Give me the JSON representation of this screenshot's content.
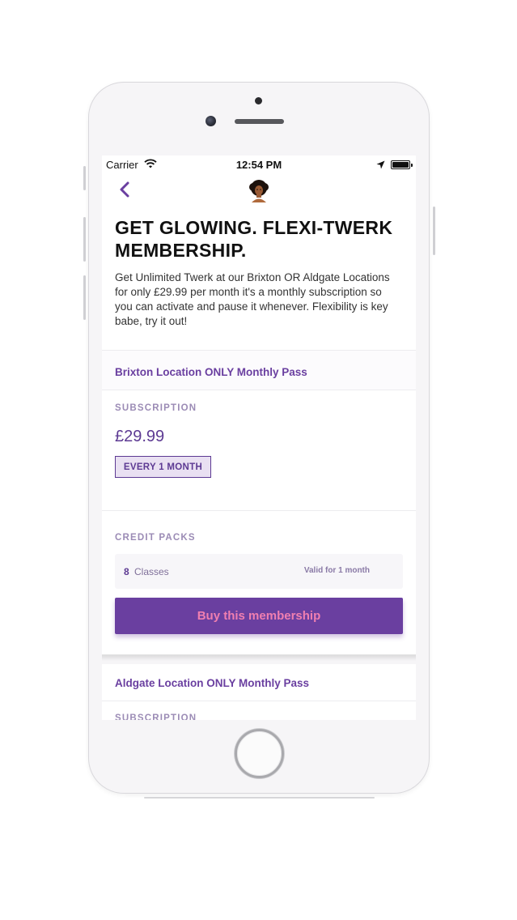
{
  "status_bar": {
    "carrier": "Carrier",
    "time": "12:54 PM"
  },
  "icons": {
    "back": "chevron-left-icon",
    "avatar": "profile-avatar-icon",
    "wifi": "wifi-icon",
    "location": "location-arrow-icon",
    "battery": "battery-icon"
  },
  "colors": {
    "brand_purple": "#6a3fa0",
    "button_text_pink": "#f07fb0",
    "badge_bg": "#e9e0f2"
  },
  "page": {
    "title": "GET GLOWING. FLEXI-TWERK MEMBERSHIP.",
    "description": "Get Unlimited Twerk at our Brixton OR Aldgate Locations for only £29.99 per month it's a monthly subscription so you can activate and pause it whenever. Flexibility is key babe, try it out!"
  },
  "memberships": [
    {
      "name": "Brixton Location ONLY Monthly Pass",
      "subscription_label": "SUBSCRIPTION",
      "price": "£29.99",
      "interval": "EVERY 1 MONTH",
      "credit_packs_label": "CREDIT PACKS",
      "credit_count": "8",
      "credit_unit": "Classes",
      "validity": "Valid for 1 month",
      "buy_label": "Buy this membership"
    },
    {
      "name": "Aldgate Location ONLY Monthly Pass",
      "subscription_label": "SUBSCRIPTION"
    }
  ]
}
